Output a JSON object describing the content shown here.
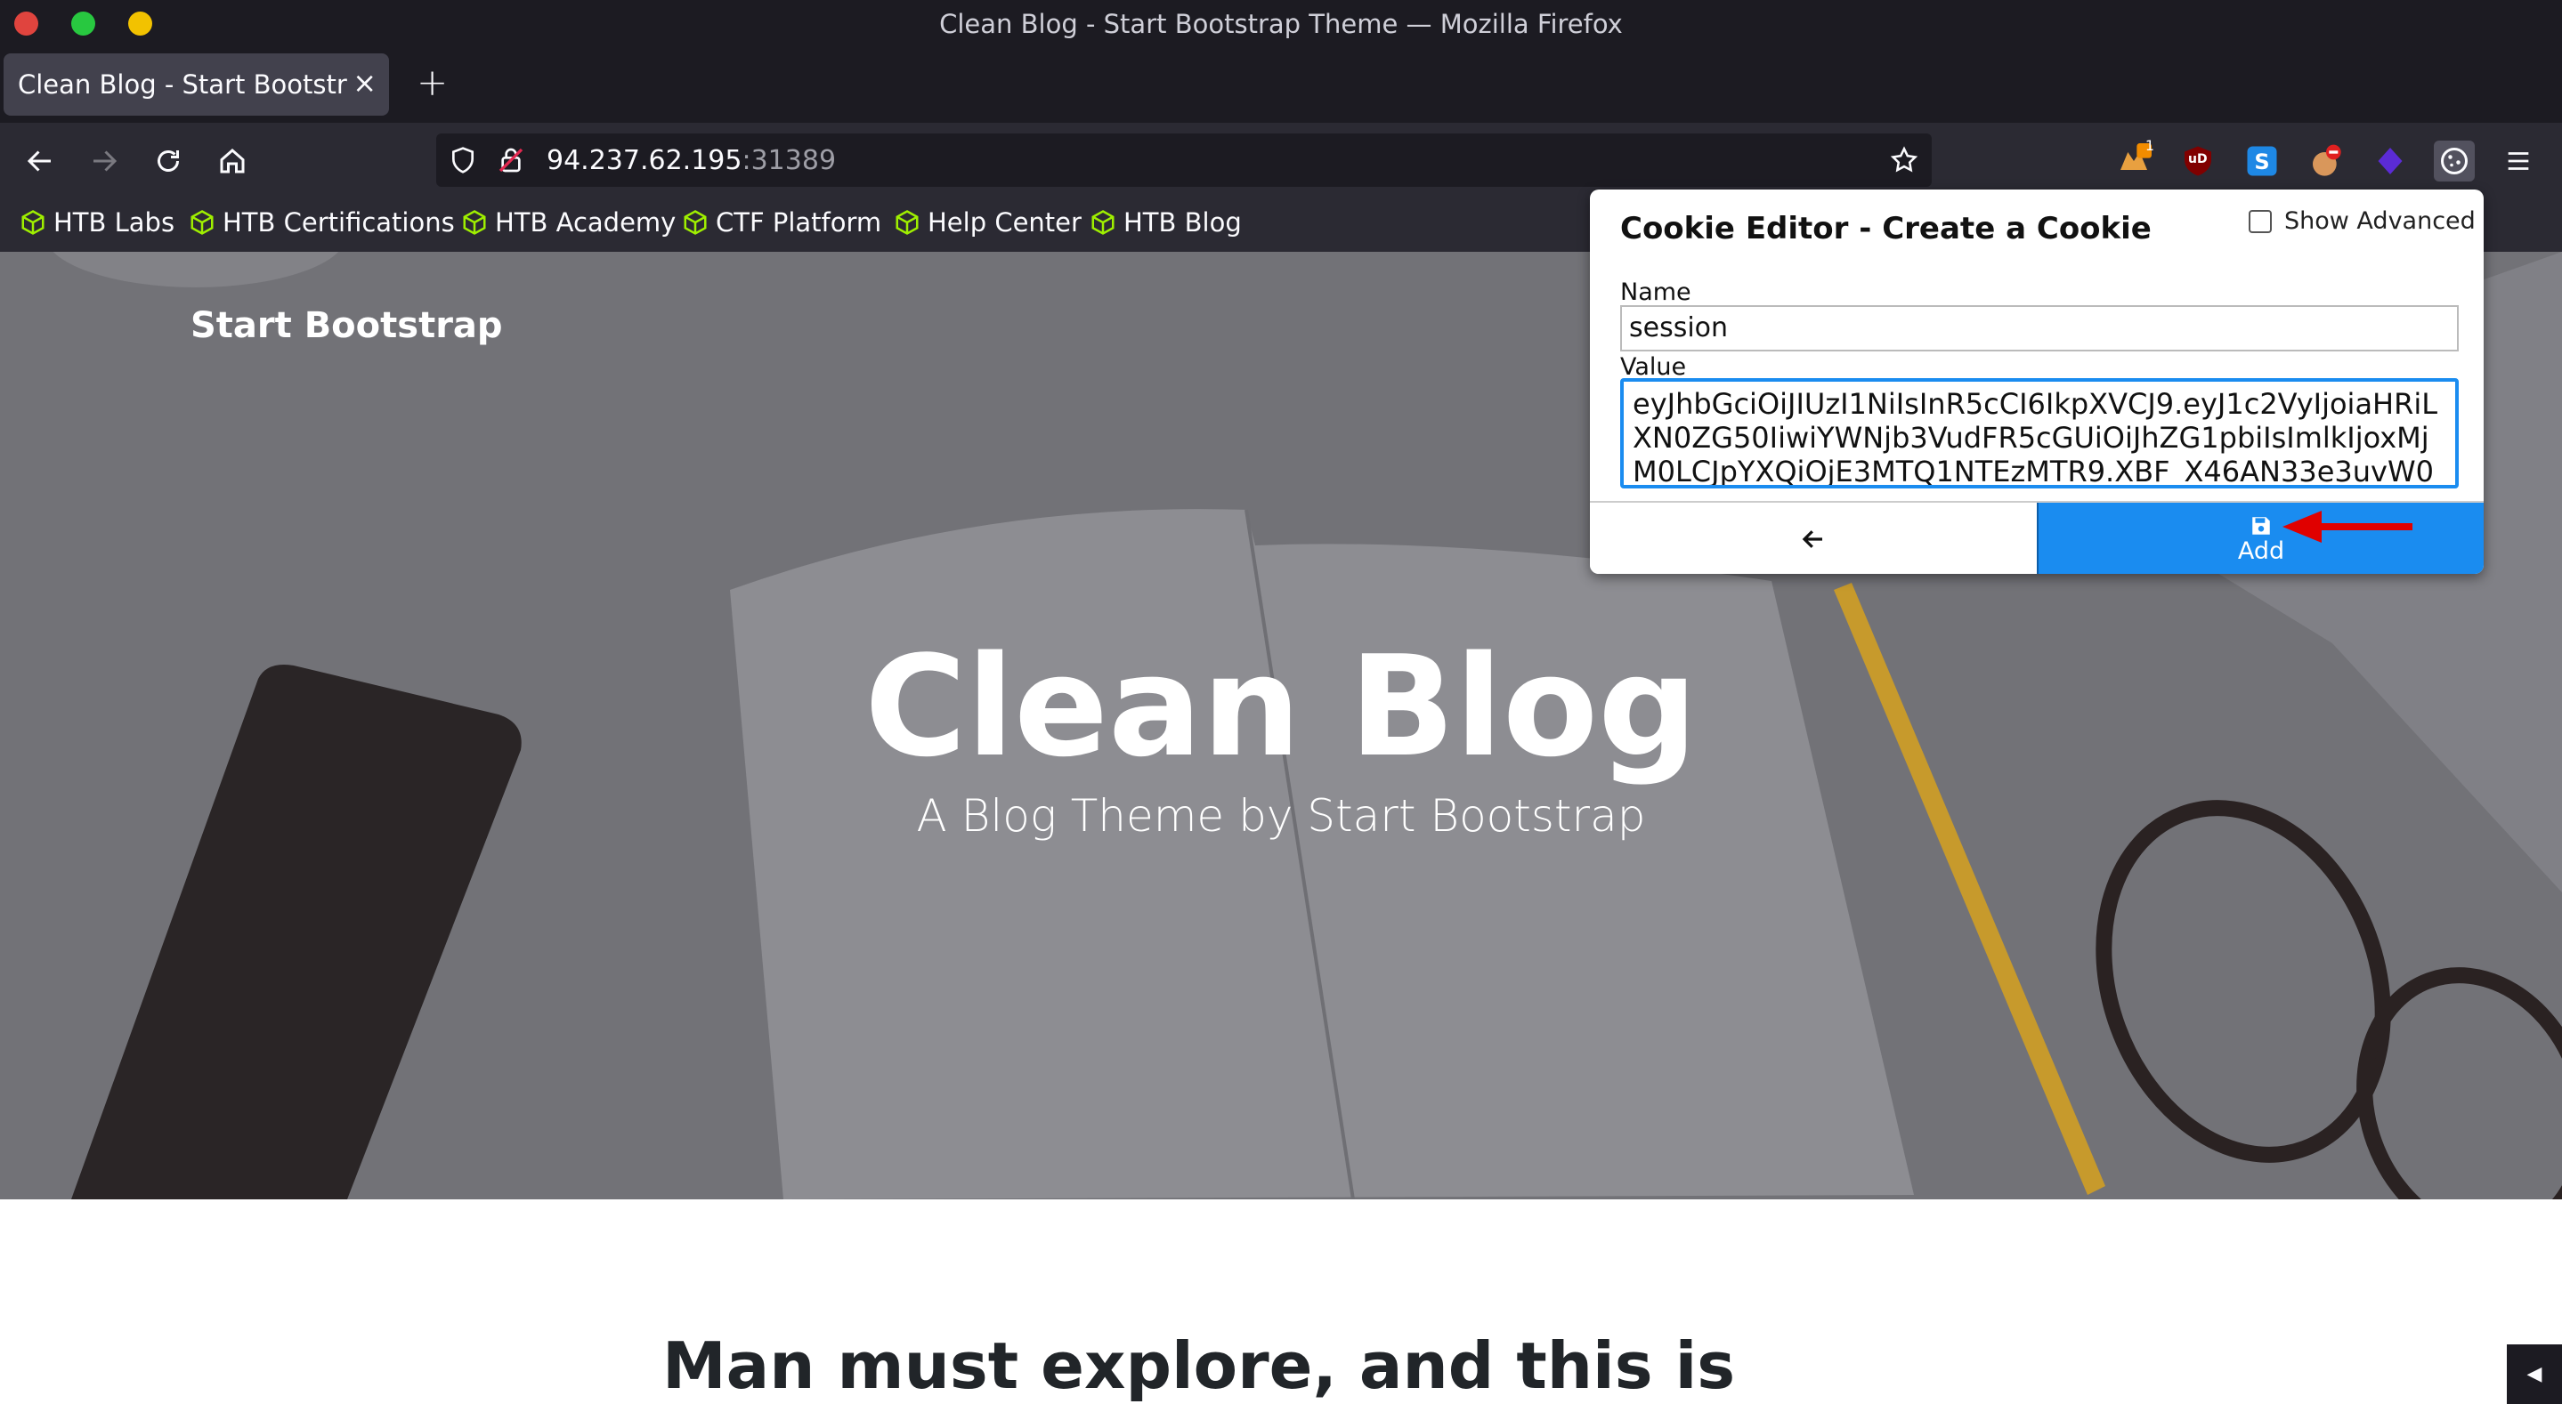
{
  "window": {
    "title": "Clean Blog - Start Bootstrap Theme — Mozilla Firefox"
  },
  "tabs": [
    {
      "label": "Clean Blog - Start Bootstrap Theme",
      "close": "×"
    }
  ],
  "new_tab": "+",
  "urlbar": {
    "host": "94.237.62.195",
    "port": ":31389"
  },
  "bookmarks": [
    {
      "label": "HTB Labs"
    },
    {
      "label": "HTB Certifications"
    },
    {
      "label": "HTB Academy"
    },
    {
      "label": "CTF Platform"
    },
    {
      "label": "Help Center"
    },
    {
      "label": "HTB Blog"
    }
  ],
  "extensions": {
    "badge_count": "1",
    "ublock_label": "uD"
  },
  "page": {
    "brand": "Start Bootstrap",
    "hero_title": "Clean Blog",
    "hero_subtitle": "A Blog Theme by Start Bootstrap",
    "post_heading": "Man must explore, and this is"
  },
  "cookie_editor": {
    "title": "Cookie Editor - Create a Cookie",
    "show_advanced_label": "Show Advanced",
    "show_advanced_checked": false,
    "name_label": "Name",
    "name_value": "session",
    "value_label": "Value",
    "value_text": "eyJhbGciOiJIUzI1NiIsInR5cCI6IkpXVCJ9.eyJ1c2VyIjoiaHRiLXN0ZG50IiwiYWNjb3VudFR5cGUiOiJhZG1pbiIsImlkIjoxMjM0LCJpYXQiOjE3MTQ1NTEzMTR9.XBF_X46AN33e3uvW0",
    "add_label": "Add"
  },
  "colors": {
    "accent_blue": "#1a8cf0",
    "annotation_red": "#e00000",
    "bookmark_icon_green": "#9fef00"
  }
}
